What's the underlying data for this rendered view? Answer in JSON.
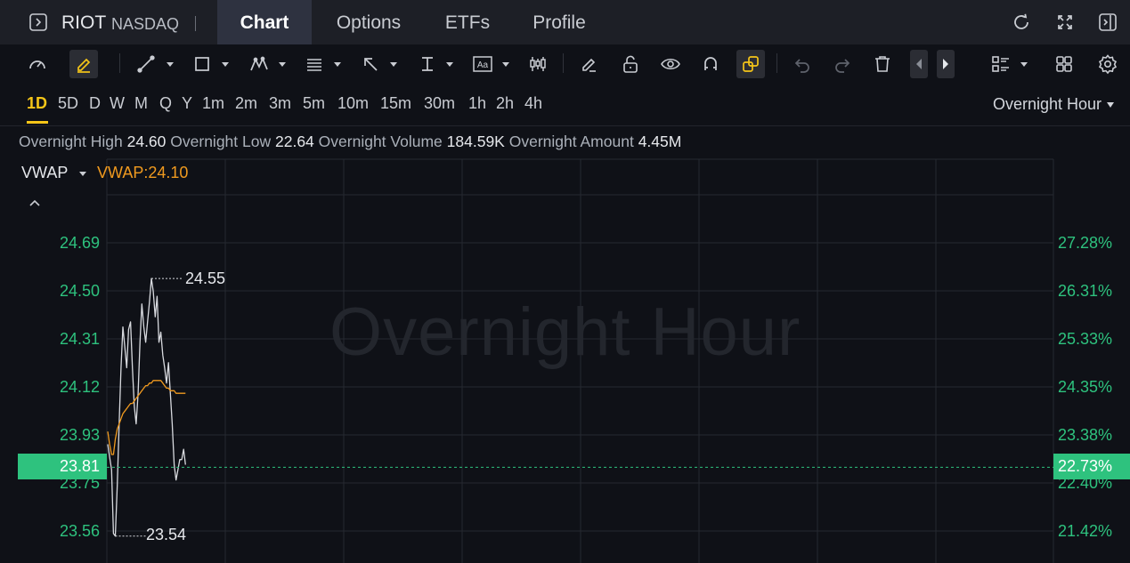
{
  "header": {
    "ticker": "RIOT",
    "exchange": "NASDAQ",
    "separator": "|",
    "tabs": [
      {
        "label": "Chart",
        "active": true
      },
      {
        "label": "Options",
        "active": false
      },
      {
        "label": "ETFs",
        "active": false
      },
      {
        "label": "Profile",
        "active": false
      }
    ],
    "icons": [
      "sidebar-toggle-icon",
      "refresh-icon",
      "fullscreen-icon",
      "panel-toggle-icon"
    ]
  },
  "toolbar": {
    "tools": [
      "gauge-icon",
      "pencil-highlight-icon",
      "trend-line-icon",
      "rectangle-icon",
      "pattern-icon",
      "fib-icon",
      "arrow-icon",
      "measure-icon",
      "text-icon",
      "candles-icon",
      "brush-icon",
      "lock-icon",
      "eye-icon",
      "magnet-icon",
      "link-icon",
      "undo-icon",
      "redo-icon",
      "trash-icon",
      "left-arrow-icon",
      "right-arrow-icon",
      "layout-icon",
      "grid-icon",
      "settings-icon"
    ],
    "text_tool_label": "Aa"
  },
  "periods": {
    "items": [
      "1D",
      "5D",
      "D",
      "W",
      "M",
      "Q",
      "Y",
      "1m",
      "2m",
      "3m",
      "5m",
      "10m",
      "15m",
      "30m",
      "1h",
      "2h",
      "4h"
    ],
    "active": "1D"
  },
  "session": {
    "label": "Overnight Hour"
  },
  "stats": {
    "high_label": "Overnight High",
    "high_value": "24.60",
    "low_label": "Overnight Low",
    "low_value": "22.64",
    "volume_label": "Overnight Volume",
    "volume_value": "184.59K",
    "amount_label": "Overnight Amount",
    "amount_value": "4.45M"
  },
  "indicator": {
    "name": "VWAP",
    "value_text": "VWAP:24.10"
  },
  "colors": {
    "accent": "#f5c518",
    "up": "#2ec27e",
    "vwap": "#f09a1f",
    "price_line": "#d8dadf",
    "background": "#0f1117"
  },
  "chart_data": {
    "type": "line",
    "watermark": "Overnight Hour",
    "ylim": [
      23.51,
      24.85
    ],
    "y_ticks_left": [
      "24.69",
      "24.50",
      "24.31",
      "24.12",
      "23.93",
      "23.75",
      "23.56"
    ],
    "y_ticks_right": [
      "27.28%",
      "26.31%",
      "25.33%",
      "24.35%",
      "23.38%",
      "22.40%",
      "21.42%"
    ],
    "current_price": "23.81",
    "current_change": "22.73%",
    "high_label": "24.55",
    "low_label": "23.54",
    "series": [
      {
        "values": [
          23.9,
          23.85,
          23.8,
          23.55,
          23.54,
          23.74,
          23.98,
          24.2,
          24.36,
          24.28,
          24.2,
          24.35,
          24.38,
          24.2,
          24.05,
          23.98,
          24.1,
          24.3,
          24.45,
          24.36,
          24.3,
          24.38,
          24.46,
          24.55,
          24.5,
          24.4,
          24.48,
          24.3,
          24.34,
          24.25,
          24.2,
          24.14,
          24.22,
          24.1,
          23.98,
          23.82,
          23.76,
          23.8,
          23.84,
          23.84,
          23.88,
          23.82
        ]
      },
      {
        "name": "VWAP",
        "values": [
          23.95,
          23.9,
          23.86,
          23.86,
          23.92,
          23.96,
          23.98,
          24.0,
          24.02,
          24.03,
          24.04,
          24.05,
          24.06,
          24.06,
          24.07,
          24.08,
          24.09,
          24.1,
          24.11,
          24.12,
          24.13,
          24.13,
          24.14,
          24.14,
          24.15,
          24.15,
          24.15,
          24.15,
          24.15,
          24.14,
          24.13,
          24.12,
          24.12,
          24.11,
          24.11,
          24.11,
          24.1,
          24.1,
          24.1,
          24.1,
          24.1,
          24.1
        ]
      }
    ]
  }
}
